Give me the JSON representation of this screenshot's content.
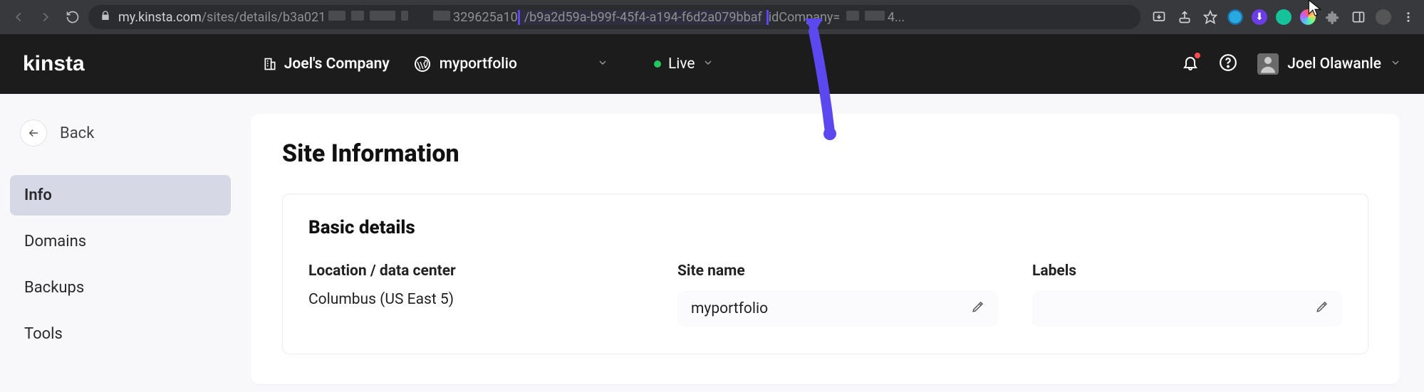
{
  "browser": {
    "url_prefix": "my.kinsta.com",
    "url_mid_visible": "/sites/details/b3a021",
    "url_segment_number": "329625a10",
    "url_highlighted": "/b9a2d59a-b99f-45f4-a194-f6d2a079bbaf",
    "url_after_highlight": "idCompany=",
    "url_tail": "4..."
  },
  "header": {
    "logo": "kinsta",
    "company_label": "Joel's Company",
    "site_label": "myportfolio",
    "env_label": "Live",
    "user_name": "Joel Olawanle"
  },
  "sidebar": {
    "back_label": "Back",
    "items": [
      {
        "label": "Info"
      },
      {
        "label": "Domains"
      },
      {
        "label": "Backups"
      },
      {
        "label": "Tools"
      }
    ]
  },
  "page": {
    "title": "Site Information",
    "panel_title": "Basic details",
    "location_label": "Location / data center",
    "location_value": "Columbus (US East 5)",
    "sitename_label": "Site name",
    "sitename_value": "myportfolio",
    "labels_label": "Labels",
    "labels_value": ""
  }
}
